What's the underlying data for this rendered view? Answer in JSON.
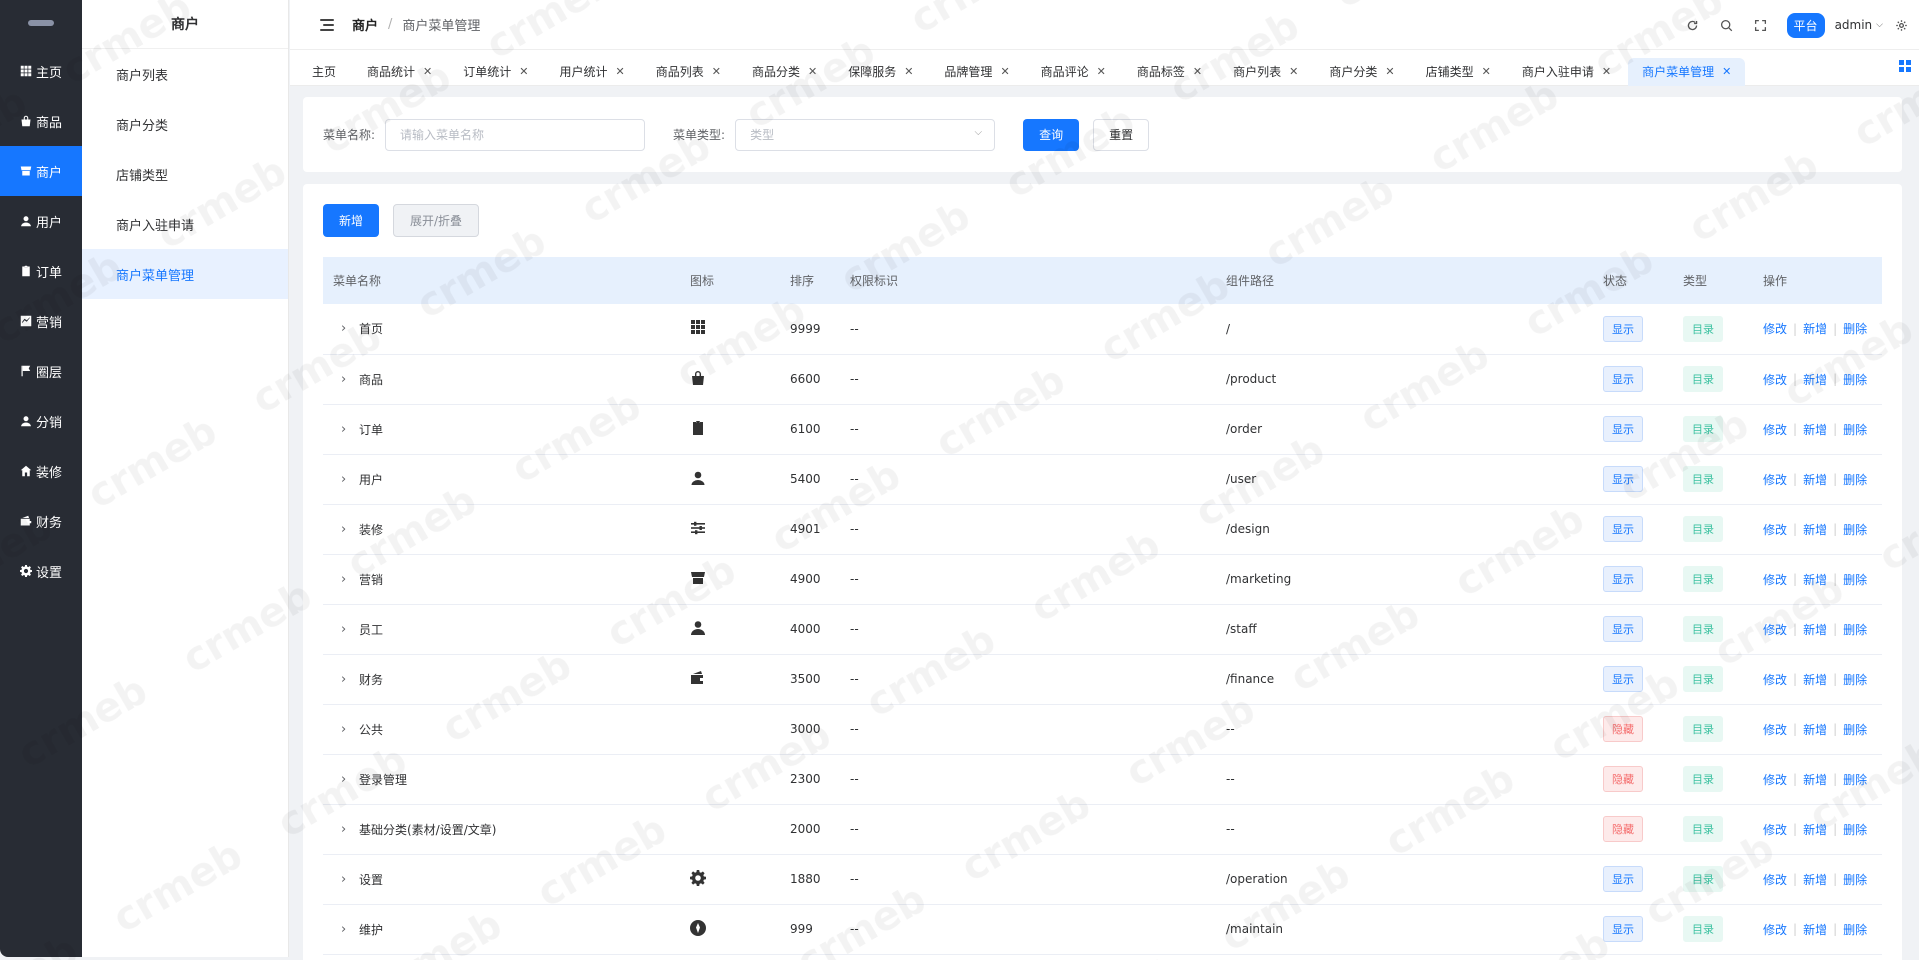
{
  "rail": {
    "items": [
      {
        "label": "主页",
        "icon": "grid-icon"
      },
      {
        "label": "商品",
        "icon": "bag-icon"
      },
      {
        "label": "商户",
        "icon": "store-icon"
      },
      {
        "label": "用户",
        "icon": "user-icon"
      },
      {
        "label": "订单",
        "icon": "clipboard-icon"
      },
      {
        "label": "营销",
        "icon": "chart-icon"
      },
      {
        "label": "圈层",
        "icon": "flag-icon"
      },
      {
        "label": "分销",
        "icon": "user-icon"
      },
      {
        "label": "装修",
        "icon": "home-icon"
      },
      {
        "label": "财务",
        "icon": "wallet-icon"
      },
      {
        "label": "设置",
        "icon": "gear-icon"
      }
    ],
    "active_index": 2
  },
  "subnav": {
    "title": "商户",
    "items": [
      "商户列表",
      "商户分类",
      "店铺类型",
      "商户入驻申请",
      "商户菜单管理"
    ],
    "active_index": 4
  },
  "header": {
    "breadcrumb": [
      "商户",
      "商户菜单管理"
    ],
    "platform_label": "平台",
    "user": "admin"
  },
  "tabs": {
    "items": [
      "主页",
      "商品统计",
      "订单统计",
      "用户统计",
      "商品列表",
      "商品分类",
      "保障服务",
      "品牌管理",
      "商品评论",
      "商品标签",
      "商户列表",
      "商户分类",
      "店铺类型",
      "商户入驻申请",
      "商户菜单管理"
    ],
    "active_index": 14
  },
  "search": {
    "name_label": "菜单名称:",
    "name_placeholder": "请输入菜单名称",
    "type_label": "菜单类型:",
    "type_placeholder": "类型",
    "query_label": "查询",
    "reset_label": "重置"
  },
  "toolbar": {
    "add_label": "新增",
    "toggle_label": "展开/折叠"
  },
  "table": {
    "columns": [
      "菜单名称",
      "图标",
      "排序",
      "权限标识",
      "组件路径",
      "状态",
      "类型",
      "操作"
    ],
    "actions": [
      "修改",
      "新增",
      "删除"
    ],
    "rows": [
      {
        "name": "首页",
        "icon": "grid-icon",
        "sort": "9999",
        "perm": "--",
        "path": "/",
        "status": "显示",
        "type": "目录"
      },
      {
        "name": "商品",
        "icon": "bag-icon",
        "sort": "6600",
        "perm": "--",
        "path": "/product",
        "status": "显示",
        "type": "目录"
      },
      {
        "name": "订单",
        "icon": "clipboard-icon",
        "sort": "6100",
        "perm": "--",
        "path": "/order",
        "status": "显示",
        "type": "目录"
      },
      {
        "name": "用户",
        "icon": "user-icon",
        "sort": "5400",
        "perm": "--",
        "path": "/user",
        "status": "显示",
        "type": "目录"
      },
      {
        "name": "装修",
        "icon": "sliders-icon",
        "sort": "4901",
        "perm": "--",
        "path": "/design",
        "status": "显示",
        "type": "目录"
      },
      {
        "name": "营销",
        "icon": "store-icon",
        "sort": "4900",
        "perm": "--",
        "path": "/marketing",
        "status": "显示",
        "type": "目录"
      },
      {
        "name": "员工",
        "icon": "staff-icon",
        "sort": "4000",
        "perm": "--",
        "path": "/staff",
        "status": "显示",
        "type": "目录"
      },
      {
        "name": "财务",
        "icon": "wallet-icon",
        "sort": "3500",
        "perm": "--",
        "path": "/finance",
        "status": "显示",
        "type": "目录"
      },
      {
        "name": "公共",
        "icon": "",
        "sort": "3000",
        "perm": "--",
        "path": "--",
        "status": "隐藏",
        "type": "目录"
      },
      {
        "name": "登录管理",
        "icon": "",
        "sort": "2300",
        "perm": "--",
        "path": "--",
        "status": "隐藏",
        "type": "目录"
      },
      {
        "name": "基础分类(素材/设置/文章)",
        "icon": "",
        "sort": "2000",
        "perm": "--",
        "path": "--",
        "status": "隐藏",
        "type": "目录"
      },
      {
        "name": "设置",
        "icon": "gear-icon",
        "sort": "1880",
        "perm": "--",
        "path": "/operation",
        "status": "显示",
        "type": "目录"
      },
      {
        "name": "维护",
        "icon": "compass-icon",
        "sort": "999",
        "perm": "--",
        "path": "/maintain",
        "status": "显示",
        "type": "目录"
      }
    ]
  },
  "colors": {
    "primary": "#1677ff",
    "rail_bg": "#282c34",
    "show": "#1677ff",
    "hide": "#f56c6c",
    "dir": "#3cc2a1"
  },
  "watermark": "crmeb"
}
